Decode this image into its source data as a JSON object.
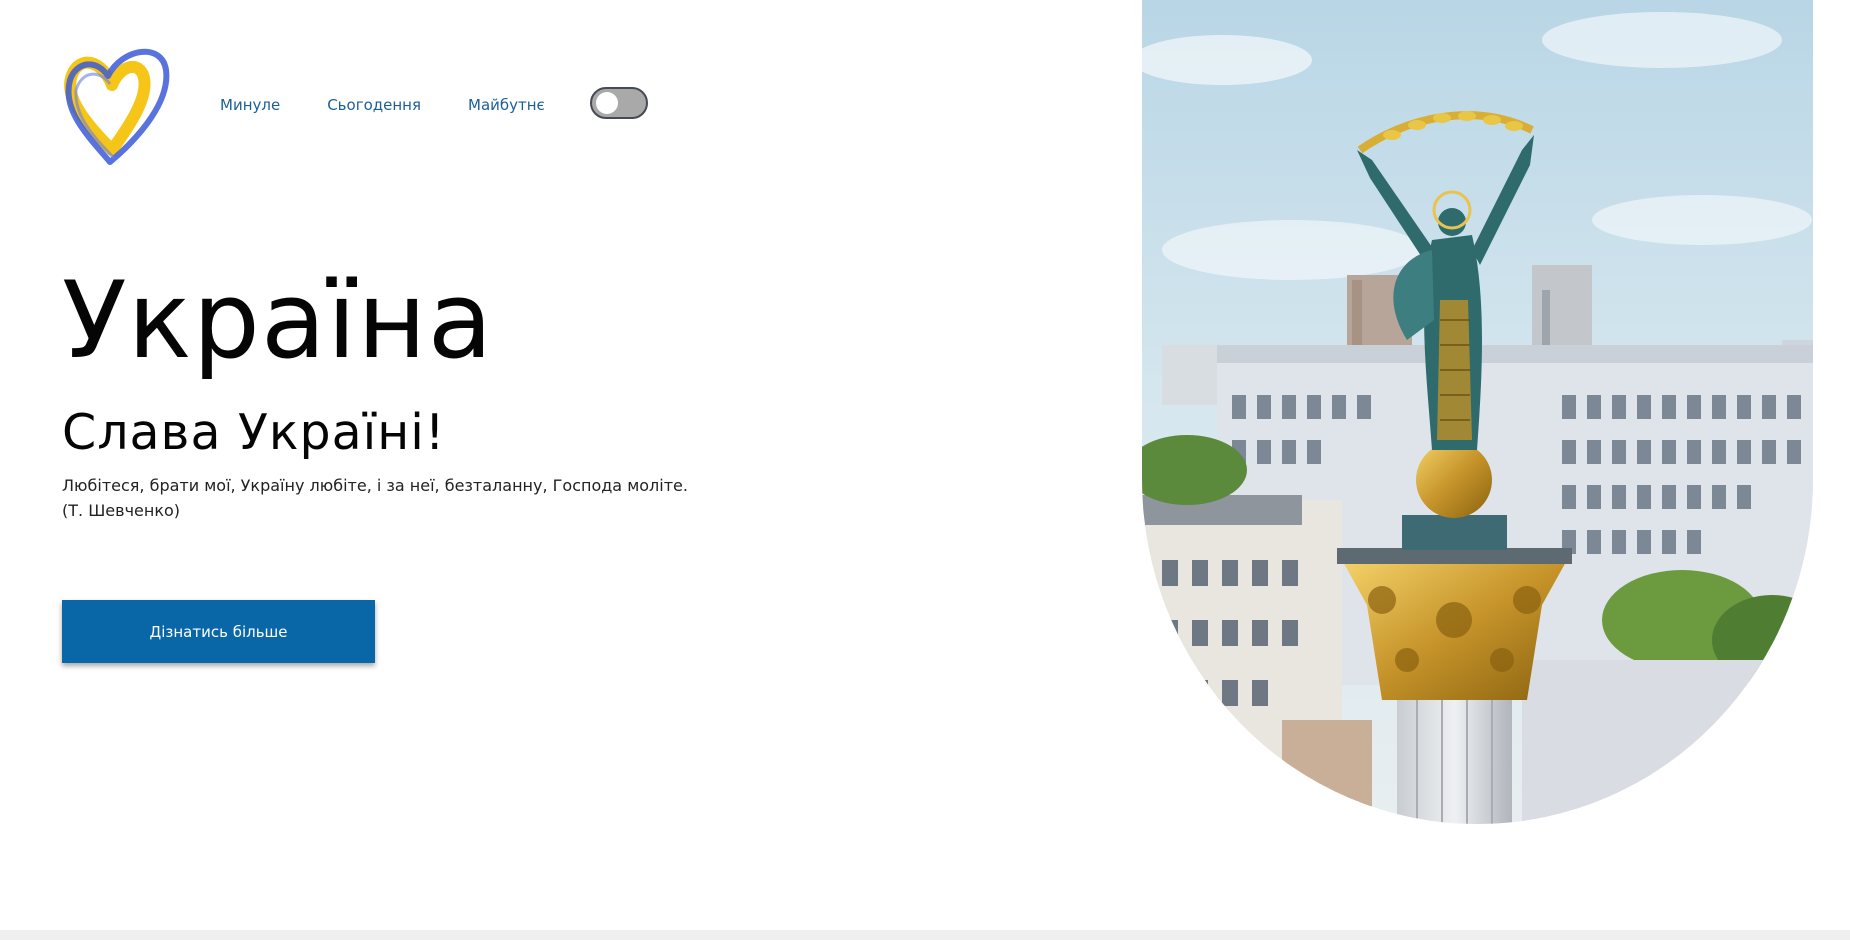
{
  "nav": {
    "items": [
      {
        "label": "Минуле"
      },
      {
        "label": "Сьогодення"
      },
      {
        "label": "Майбутнє"
      }
    ]
  },
  "theme_toggle": {
    "state": "off"
  },
  "hero": {
    "title": "Україна",
    "subtitle": "Слава Україні!",
    "quote": "Любітеся, брати мої, Україну любіте, і за неї, безталанну, Господа моліте.",
    "quote_author": "(Т. Шевченко)",
    "cta_label": "Дізнатись більше"
  },
  "colors": {
    "accent": "#0967a8",
    "nav_link": "#1b5f9a",
    "logo_blue": "#3b5bd8",
    "logo_yellow": "#f5c518"
  },
  "icons": {
    "logo": "heart-logo-icon"
  }
}
